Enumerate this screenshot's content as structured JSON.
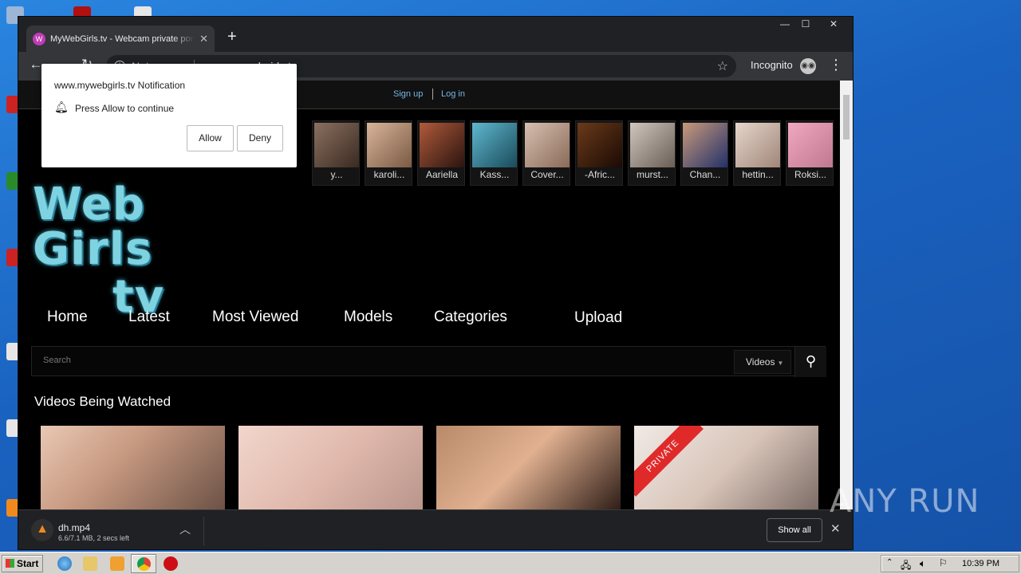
{
  "browser": {
    "tab_title": "MyWebGirls.tv - Webcam private porn",
    "tab_favicon": "W",
    "new_tab": "+",
    "security": "Not secure",
    "url": "www.mywebgirls.tv",
    "incognito_label": "Incognito"
  },
  "site": {
    "auth": {
      "signup": "Sign up",
      "login": "Log in"
    },
    "models": [
      "y...",
      "karoli...",
      "Aariella",
      "Kass...",
      "Cover...",
      "-Afric...",
      "murst...",
      "Chan...",
      "hettin...",
      "Roksi..."
    ],
    "logo": {
      "line1": "Web Girls",
      "line2": "tv"
    },
    "nav": [
      "Home",
      "Latest",
      "Most Viewed",
      "Models",
      "Categories",
      "Upload"
    ],
    "search": {
      "placeholder": "Search",
      "type_select": "Videos"
    },
    "section_title": "Videos Being Watched",
    "videos": [
      {
        "badge": ""
      },
      {
        "badge": ""
      },
      {
        "badge": ""
      },
      {
        "badge": "PRIVATE"
      }
    ]
  },
  "notification": {
    "title": "www.mywebgirls.tv Notification",
    "message": "Press Allow to continue",
    "allow": "Allow",
    "deny": "Deny"
  },
  "download": {
    "filename": "dh.mp4",
    "status": "6.6/7.1 MB, 2 secs left",
    "show_all": "Show all"
  },
  "watermark": "ANY RUN",
  "taskbar": {
    "start": "Start",
    "clock": "10:39 PM"
  },
  "colors": {
    "accent_link": "#74b7e6",
    "logo": "#7fd3e0",
    "private_badge": "#e02a2a"
  }
}
